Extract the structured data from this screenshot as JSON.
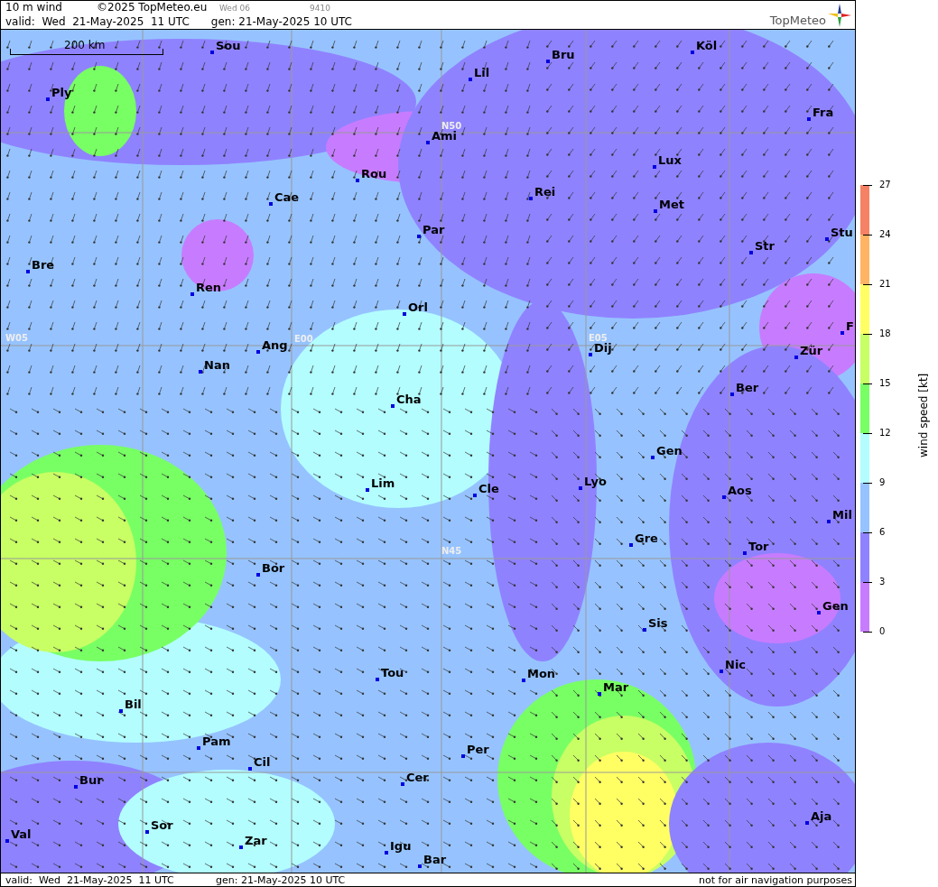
{
  "header": {
    "title": "10 m wind",
    "copyright": "©2025 TopMeteo.eu",
    "run_day": "Wed 06",
    "code": "9410",
    "valid": "valid:  Wed  21-May-2025  11 UTC",
    "generated": "gen: 21-May-2025 10 UTC",
    "logo": "TopMeteo"
  },
  "map": {
    "scale": "200 km",
    "grid_labels": [
      "N50",
      "W05",
      "E00",
      "E05",
      "N45"
    ],
    "cities": [
      "Sou",
      "Bru",
      "Köl",
      "Lil",
      "Ply",
      "Ami",
      "Fra",
      "Lux",
      "Rou",
      "Cae",
      "Rei",
      "Met",
      "Par",
      "Stu",
      "Str",
      "Bre",
      "Ren",
      "Orl",
      "Ang",
      "Dij",
      "Zür",
      "F",
      "Nan",
      "Ber",
      "Cha",
      "Gen",
      "Lim",
      "Cle",
      "Lyo",
      "Aos",
      "Mil",
      "Gre",
      "Tor",
      "Bor",
      "Gen",
      "Sis",
      "Tou",
      "Mon",
      "Nic",
      "Mar",
      "Bil",
      "Pam",
      "Per",
      "Cil",
      "Cer",
      "Bur",
      "Sor",
      "Aja",
      "Val",
      "Zar",
      "Igu",
      "Bar"
    ]
  },
  "legend": {
    "title": "wind speed [kt]",
    "ticks": [
      "27",
      "24",
      "21",
      "18",
      "15",
      "12",
      "9",
      "6",
      "3",
      "0"
    ],
    "bands": [
      {
        "color": "#f58264"
      },
      {
        "color": "#ffb464"
      },
      {
        "color": "#ffff64"
      },
      {
        "color": "#c8ff64"
      },
      {
        "color": "#78ff64"
      },
      {
        "color": "#b3fdff"
      },
      {
        "color": "#96c3ff"
      },
      {
        "color": "#8f82ff"
      },
      {
        "color": "#c77cff"
      }
    ]
  },
  "footer": {
    "valid": "valid:  Wed  21-May-2025  11 UTC",
    "generated": "gen: 21-May-2025 10 UTC",
    "notice": "not for air navigation purposes"
  }
}
